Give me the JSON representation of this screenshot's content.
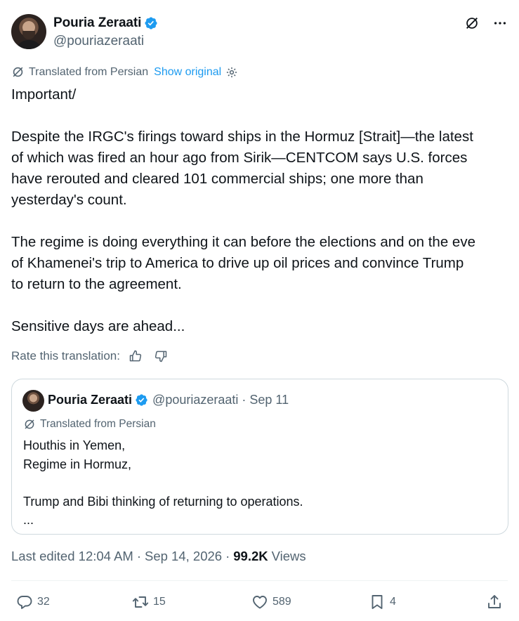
{
  "author": {
    "display_name": "Pouria Zeraati",
    "handle": "@pouriazeraati",
    "verified": true
  },
  "header_icons": [
    "translate-off-icon",
    "more-icon"
  ],
  "translation": {
    "label": "Translated from Persian",
    "show_original": "Show original"
  },
  "tweet": {
    "paragraphs": [
      "Important/",
      "Despite the IRGC's firings toward ships in the Hormuz [Strait]—the latest\nof which was fired an hour ago from Sirik—CENTCOM says U.S. forces\nhave rerouted and cleared 101 commercial ships; one more than\nyesterday's count.",
      "The regime is doing everything it can before the elections and on the eve\nof Khamenei's trip to America to drive up oil prices and convince Trump\nto return to the agreement.",
      "Sensitive days are ahead..."
    ]
  },
  "rate_translation": {
    "label": "Rate this translation:"
  },
  "quote": {
    "display_name": "Pouria Zeraati",
    "handle": "@pouriazeraati",
    "separator": "·",
    "date": "Sep 11",
    "translated_label": "Translated from Persian",
    "lines": [
      "Houthis in Yemen,",
      "Regime in Hormuz,",
      "",
      "Trump and Bibi thinking of returning to operations.",
      "..."
    ]
  },
  "meta": {
    "edited": "Last edited 12:04 AM",
    "separator": "·",
    "date": "Sep 14, 2026",
    "views_count": "99.2K",
    "views_label": "Views"
  },
  "actions": {
    "replies": "32",
    "reposts": "15",
    "likes": "589",
    "bookmarks": "4"
  },
  "colors": {
    "accent": "#1d9bf0",
    "text": "#0f1419",
    "secondary": "#536471",
    "border": "#cfd9de"
  }
}
